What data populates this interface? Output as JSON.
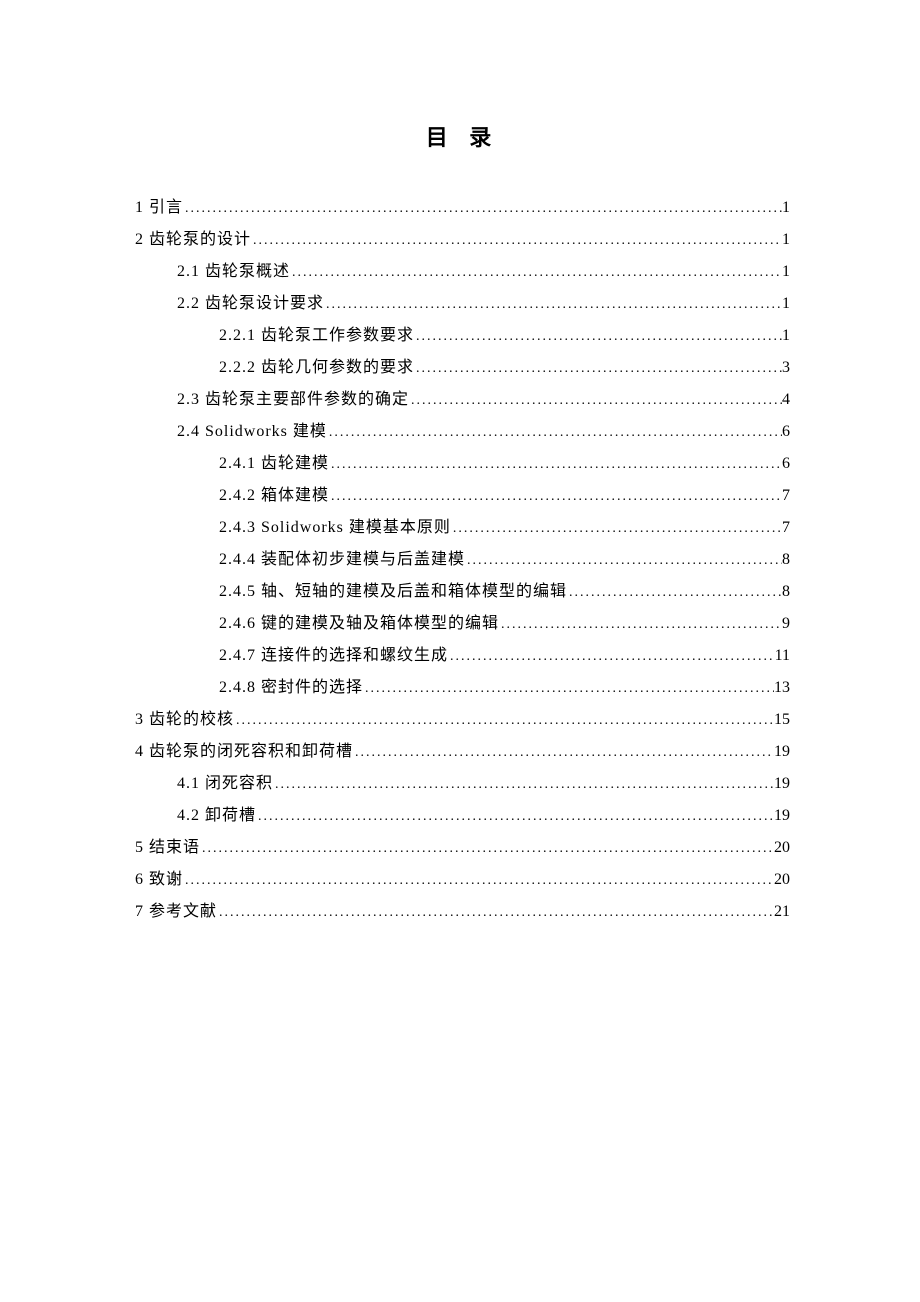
{
  "title": "目 录",
  "entries": [
    {
      "level": 1,
      "label": "1  引言",
      "page": "1"
    },
    {
      "level": 1,
      "label": "2  齿轮泵的设计",
      "page": "1"
    },
    {
      "level": 2,
      "label": "2.1  齿轮泵概述",
      "page": "1"
    },
    {
      "level": 2,
      "label": "2.2 齿轮泵设计要求",
      "page": "1"
    },
    {
      "level": 3,
      "label": "2.2.1  齿轮泵工作参数要求",
      "page": "1"
    },
    {
      "level": 3,
      "label": "2.2.2  齿轮几何参数的要求",
      "page": "3"
    },
    {
      "level": 2,
      "label": "2.3  齿轮泵主要部件参数的确定",
      "page": "4"
    },
    {
      "level": 2,
      "label": "2.4 Solidworks 建模",
      "page": "6"
    },
    {
      "level": 3,
      "label": "2.4.1  齿轮建模",
      "page": "6"
    },
    {
      "level": 3,
      "label": "2.4.2  箱体建模",
      "page": "7"
    },
    {
      "level": 3,
      "label": "2.4.3 Solidworks 建模基本原则",
      "page": "7"
    },
    {
      "level": 3,
      "label": "2.4.4  装配体初步建模与后盖建模",
      "page": "8"
    },
    {
      "level": 3,
      "label": "2.4.5  轴、短轴的建模及后盖和箱体模型的编辑",
      "page": "8"
    },
    {
      "level": 3,
      "label": "2.4.6  键的建模及轴及箱体模型的编辑",
      "page": "9"
    },
    {
      "level": 3,
      "label": "2.4.7  连接件的选择和螺纹生成",
      "page": "11"
    },
    {
      "level": 3,
      "label": "2.4.8  密封件的选择",
      "page": "13"
    },
    {
      "level": 1,
      "label": "3  齿轮的校核",
      "page": "15"
    },
    {
      "level": 1,
      "label": "4  齿轮泵的闭死容积和卸荷槽",
      "page": "19"
    },
    {
      "level": 2,
      "label": "4.1  闭死容积",
      "page": "19"
    },
    {
      "level": 2,
      "label": "4.2  卸荷槽",
      "page": "19"
    },
    {
      "level": 1,
      "label": "5  结束语",
      "page": "20"
    },
    {
      "level": 1,
      "label": "6  致谢",
      "page": "20"
    },
    {
      "level": 1,
      "label": "7  参考文献",
      "page": "21"
    }
  ]
}
